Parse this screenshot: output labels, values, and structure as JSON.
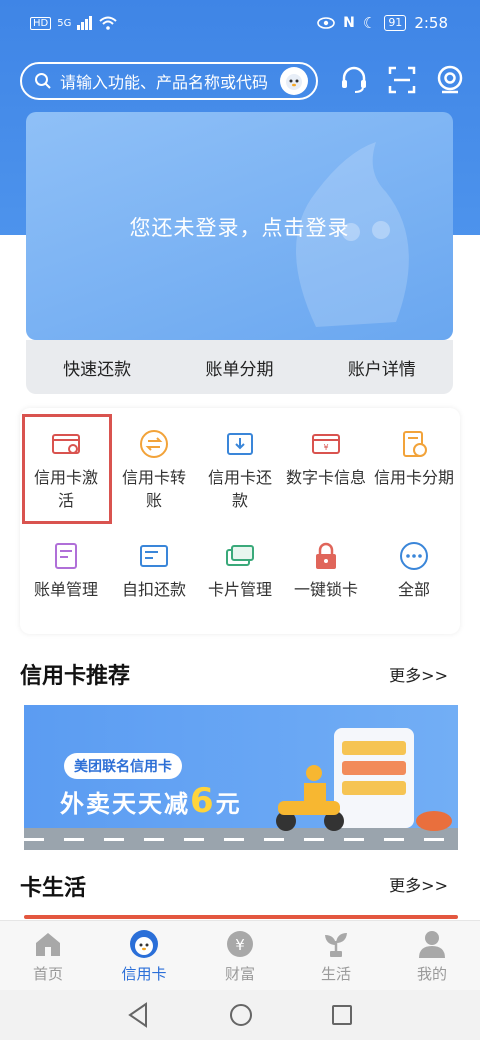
{
  "status": {
    "left_text": "HD",
    "signal_text": "5G",
    "battery": "91",
    "time": "2:58"
  },
  "search": {
    "placeholder": "请输入功能、产品名称或代码"
  },
  "hero": {
    "login_text": "您还未登录，点击登录"
  },
  "quick": [
    "快速还款",
    "账单分期",
    "账户详情"
  ],
  "grid": [
    {
      "label": "信用卡激活",
      "icon": "card-activate-icon"
    },
    {
      "label": "信用卡转账",
      "icon": "transfer-icon"
    },
    {
      "label": "信用卡还款",
      "icon": "repay-icon"
    },
    {
      "label": "数字卡信息",
      "icon": "digital-card-icon"
    },
    {
      "label": "信用卡分期",
      "icon": "installment-icon"
    },
    {
      "label": "账单管理",
      "icon": "bill-icon"
    },
    {
      "label": "自扣还款",
      "icon": "auto-repay-icon"
    },
    {
      "label": "卡片管理",
      "icon": "card-manage-icon"
    },
    {
      "label": "一键锁卡",
      "icon": "lock-icon"
    },
    {
      "label": "全部",
      "icon": "more-icon"
    }
  ],
  "recommend": {
    "title": "信用卡推荐",
    "more": "更多>>"
  },
  "banner": {
    "pill": "美团联名信用卡",
    "title": "外卖天天减",
    "amount": "6",
    "unit": "元"
  },
  "life": {
    "title": "卡生活",
    "more": "更多>>"
  },
  "tabs": [
    "首页",
    "信用卡",
    "财富",
    "生活",
    "我的"
  ],
  "colors": {
    "primary": "#3f85e6",
    "highlight": "#d9534f",
    "tab_active": "#2b6fd8"
  }
}
